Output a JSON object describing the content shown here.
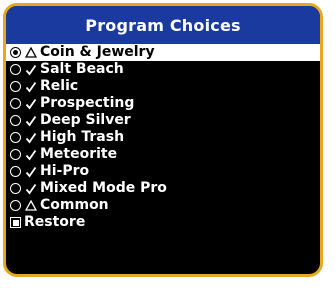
{
  "title": "Program Choices",
  "colors": {
    "title_bar": "#1a3aa0",
    "border": "#e4a91c",
    "background": "#000000",
    "text": "#ffffff",
    "selected_bg": "#ffffff",
    "selected_text": "#000000"
  },
  "programs": [
    {
      "label": "Coin & Jewelry",
      "icon": "triangle-icon",
      "selected": true
    },
    {
      "label": "Salt Beach",
      "icon": "checkmark-icon",
      "selected": false
    },
    {
      "label": "Relic",
      "icon": "checkmark-icon",
      "selected": false
    },
    {
      "label": "Prospecting",
      "icon": "checkmark-icon",
      "selected": false
    },
    {
      "label": "Deep Silver",
      "icon": "checkmark-icon",
      "selected": false
    },
    {
      "label": "High Trash",
      "icon": "checkmark-icon",
      "selected": false
    },
    {
      "label": "Meteorite",
      "icon": "checkmark-icon",
      "selected": false
    },
    {
      "label": "Hi-Pro",
      "icon": "checkmark-icon",
      "selected": false
    },
    {
      "label": "Mixed Mode Pro",
      "icon": "checkmark-icon",
      "selected": false
    },
    {
      "label": "Common",
      "icon": "triangle-icon",
      "selected": false
    }
  ],
  "restore": {
    "label": "Restore",
    "icon": "restore-icon"
  }
}
